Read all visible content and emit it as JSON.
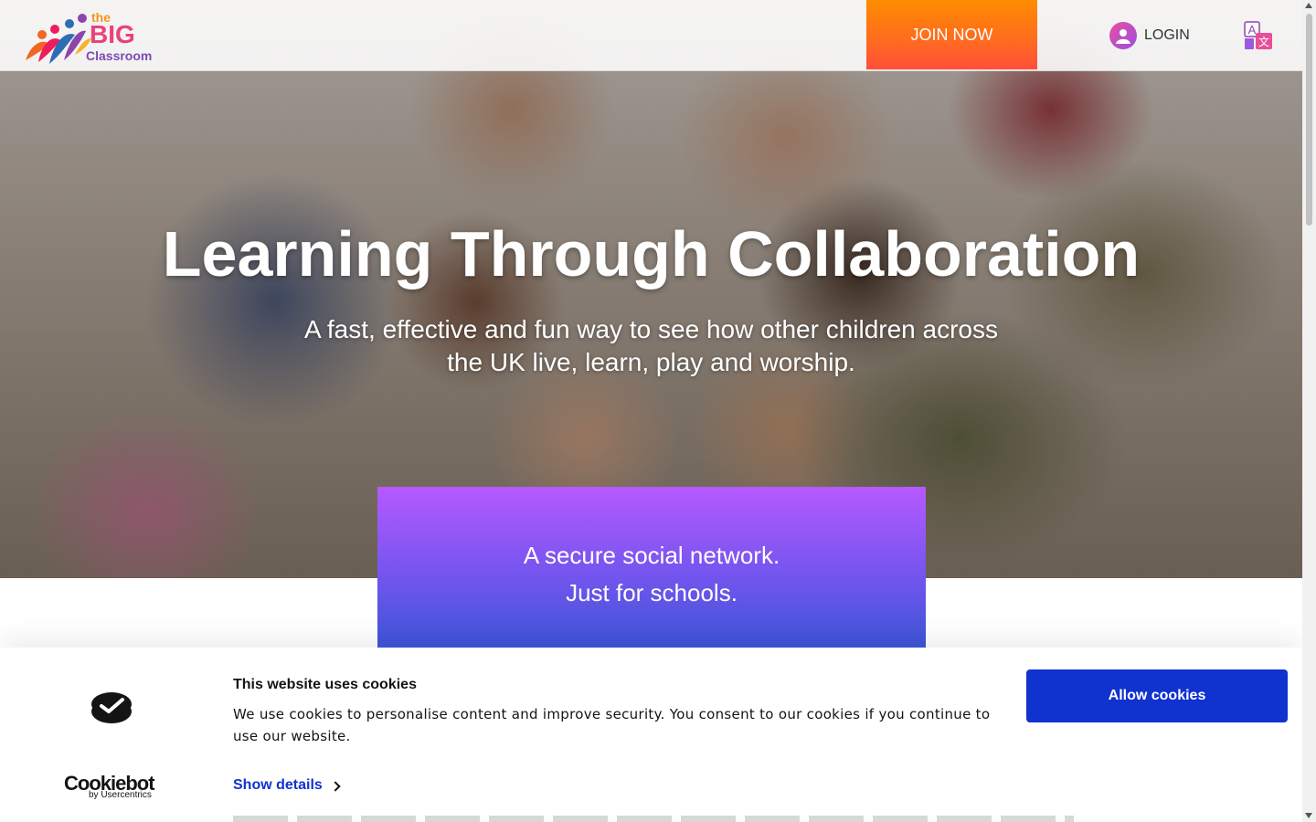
{
  "header": {
    "logo": {
      "the": "the",
      "big": "BIG",
      "classroom": "Classroom"
    },
    "join_label": "JOIN NOW",
    "login_label": "LOGIN",
    "colors": {
      "join": "#ff6a20",
      "logo_orange": "#f7941d",
      "logo_pink": "#e8427c",
      "logo_purple": "#7b4bb5"
    }
  },
  "hero": {
    "title": "Learning Through Collaboration",
    "subtitle": "A fast, effective and fun way to see how other children across the UK live, learn, play and worship."
  },
  "secure_card": {
    "line1": "A secure social network.",
    "line2": "Just for schools.",
    "colors": {
      "top": "#b659ff",
      "bottom": "#3d55d8"
    }
  },
  "cookie_banner": {
    "title": "This website uses cookies",
    "text": "We use cookies to personalise content and improve security. You consent to our cookies if you continue to use our website.",
    "show_details": "Show details",
    "allow_label": "Allow cookies",
    "brand": "Cookiebot",
    "brand_by": "by Usercentrics",
    "colors": {
      "accent": "#1032cf"
    }
  },
  "icons": {
    "user": "user-avatar-icon",
    "translate": "translate-icon",
    "chevron": "chevron-right-icon",
    "cookiebot": "cookiebot-logo-icon"
  }
}
